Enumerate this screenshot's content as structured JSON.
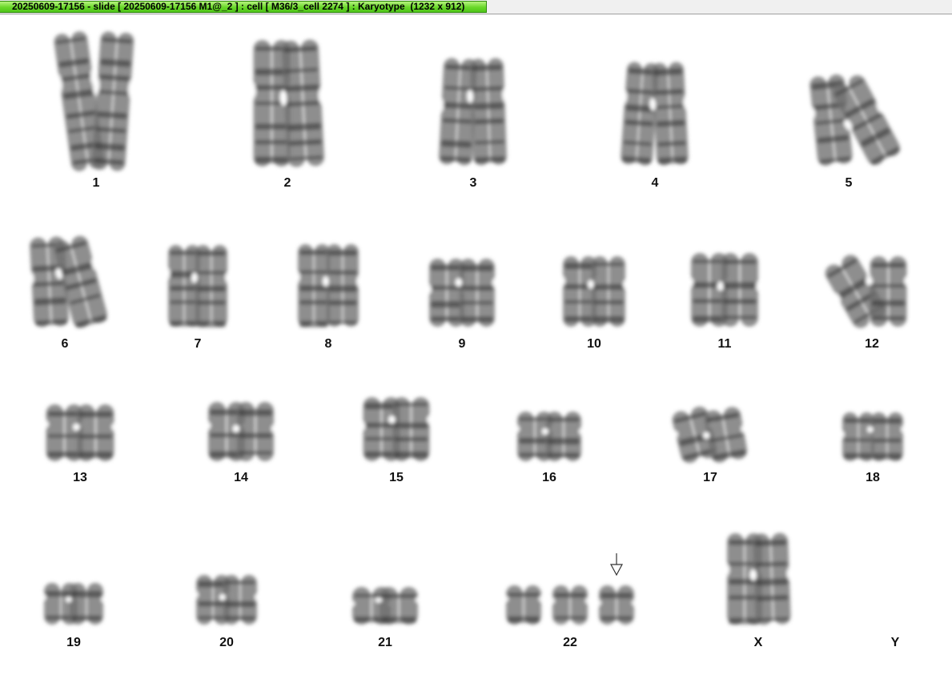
{
  "window": {
    "title": "20250609-17156 - slide [ 20250609-17156 M1@_2 ] : cell [ M36/3_cell 2274 ] : Karyotype  (1232 x 912)"
  },
  "karyotype": {
    "chromosomes": [
      {
        "id": "1",
        "label": "1",
        "count": 2
      },
      {
        "id": "2",
        "label": "2",
        "count": 2
      },
      {
        "id": "3",
        "label": "3",
        "count": 2
      },
      {
        "id": "4",
        "label": "4",
        "count": 2
      },
      {
        "id": "5",
        "label": "5",
        "count": 2
      },
      {
        "id": "6",
        "label": "6",
        "count": 2
      },
      {
        "id": "7",
        "label": "7",
        "count": 2
      },
      {
        "id": "8",
        "label": "8",
        "count": 2
      },
      {
        "id": "9",
        "label": "9",
        "count": 2
      },
      {
        "id": "10",
        "label": "10",
        "count": 2
      },
      {
        "id": "11",
        "label": "11",
        "count": 2
      },
      {
        "id": "12",
        "label": "12",
        "count": 2
      },
      {
        "id": "13",
        "label": "13",
        "count": 2
      },
      {
        "id": "14",
        "label": "14",
        "count": 2
      },
      {
        "id": "15",
        "label": "15",
        "count": 2
      },
      {
        "id": "16",
        "label": "16",
        "count": 2
      },
      {
        "id": "17",
        "label": "17",
        "count": 2
      },
      {
        "id": "18",
        "label": "18",
        "count": 2
      },
      {
        "id": "19",
        "label": "19",
        "count": 2
      },
      {
        "id": "20",
        "label": "20",
        "count": 2
      },
      {
        "id": "21",
        "label": "21",
        "count": 2
      },
      {
        "id": "22",
        "label": "22",
        "count": 3,
        "marked": true
      },
      {
        "id": "X",
        "label": "X",
        "count": 2
      },
      {
        "id": "Y",
        "label": "Y",
        "count": 0
      }
    ]
  },
  "colors": {
    "title_tab": "#69d829",
    "chromosome_fill": "#6e6e6e",
    "chromosome_band": "#2e2e2e",
    "label": "#111111",
    "arrow": "#333333"
  }
}
